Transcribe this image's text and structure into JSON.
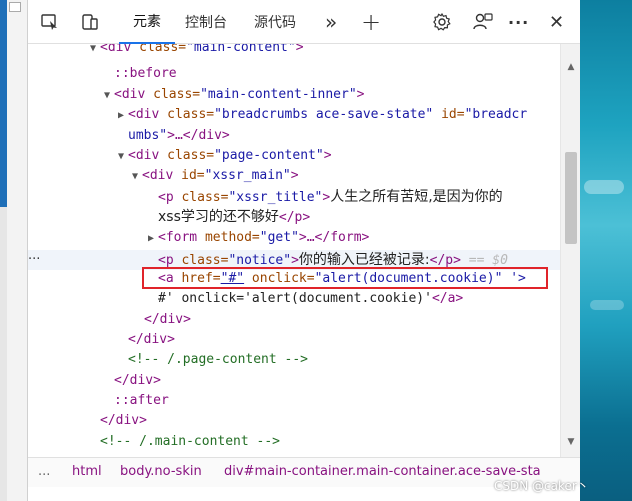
{
  "toolbar": {
    "inspect_icon": "inspect-icon",
    "device_icon": "device-emulation-icon",
    "tabs": [
      {
        "label": "元素",
        "active": true
      },
      {
        "label": "控制台",
        "active": false
      },
      {
        "label": "源代码",
        "active": false
      }
    ],
    "more_tabs": "»",
    "add": "+",
    "settings_icon": "gear-icon",
    "account_icon": "account-icon",
    "menu": "···",
    "close": "✕"
  },
  "tree": {
    "l1_tag_open": "<div ",
    "l1_attr": "class=",
    "l1_val": "\"main-content\"",
    "l1_close": ">",
    "l2": "::before",
    "l3_tag_open": "<div ",
    "l3_attr": "class=",
    "l3_val": "\"main-content-inner\"",
    "l3_close": ">",
    "l4_tag_open": "<div ",
    "l4_attr1": "class=",
    "l4_val1": "\"breadcrumbs ace-save-state\"",
    "l4_attr2": " id=",
    "l4_val2": "\"breadcr",
    "l5_val": "umbs\"",
    "l5_rest": ">…</div>",
    "l6_tag_open": "<div ",
    "l6_attr": "class=",
    "l6_val": "\"page-content\"",
    "l6_close": ">",
    "l7_tag_open": "<div ",
    "l7_attr": "id=",
    "l7_val": "\"xssr_main\"",
    "l7_close": ">",
    "l8_tag_open": "<p ",
    "l8_attr": "class=",
    "l8_val": "\"xssr_title\"",
    "l8_close": ">",
    "l8_text": "人生之所有苦短,是因为你的",
    "l9_text": "xss学习的还不够好",
    "l9_close": "</p>",
    "l10_tag_open": "<form ",
    "l10_attr": "method=",
    "l10_val": "\"get\"",
    "l10_rest": ">…</form>",
    "l11_tag_open": "<p ",
    "l11_attr": "class=",
    "l11_val": "\"notice\"",
    "l11_close": ">",
    "l11_text": "你的输入已经被记录:",
    "l11_end": "</p>",
    "l11_dollar": " == $0",
    "l12_tag_open": "<a ",
    "l12_attr1": "href=",
    "l12_val1": "\"#\"",
    "l12_attr2": " onclick=",
    "l12_val2": "\"alert(document.cookie)\"",
    "l12_val3": " '>",
    "l13_text": "#' onclick='alert(document.cookie)'",
    "l13_close": "</a>",
    "l14": "</div>",
    "l15": "</div>",
    "l16": "<!-- /.page-content -->",
    "l17": "</div>",
    "l18": "::after",
    "l19": "</div>",
    "l20": "<!-- /.main-content -->",
    "dots": "···"
  },
  "breadcrumbs": {
    "dots": "...",
    "items": [
      "html",
      "body.no-skin",
      "div#main-container.main-container.ace-save-sta"
    ]
  },
  "watermark": "CSDN @caker丶"
}
